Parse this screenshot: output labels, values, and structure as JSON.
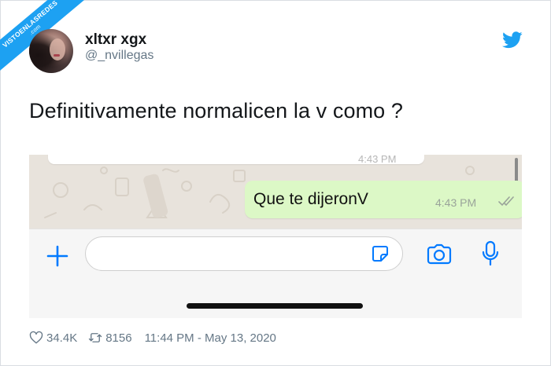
{
  "watermark": {
    "line1": "VISTOENLASREDES",
    "line2": ".com"
  },
  "author": {
    "display_name": "xltxr xgx",
    "handle": "@_nvillegas"
  },
  "tweet": {
    "text": "Definitivamente normalicen la v como ?"
  },
  "screenshot": {
    "previous_time": "4:43 PM",
    "message": {
      "text": "Que te dijeronV",
      "time": "4:43 PM"
    },
    "colors": {
      "chat_bg": "#e8e3dc",
      "bubble": "#dcf8c6",
      "accent": "#007aff"
    }
  },
  "stats": {
    "likes": "34.4K",
    "retweets": "8156",
    "timestamp": "11:44 PM - May 13, 2020"
  },
  "icons": [
    "twitter-bird-icon",
    "heart-icon",
    "retweet-icon",
    "plus-icon",
    "sticker-icon",
    "camera-icon",
    "microphone-icon",
    "double-check-icon"
  ],
  "brand": {
    "twitter_blue": "#1da1f2"
  }
}
